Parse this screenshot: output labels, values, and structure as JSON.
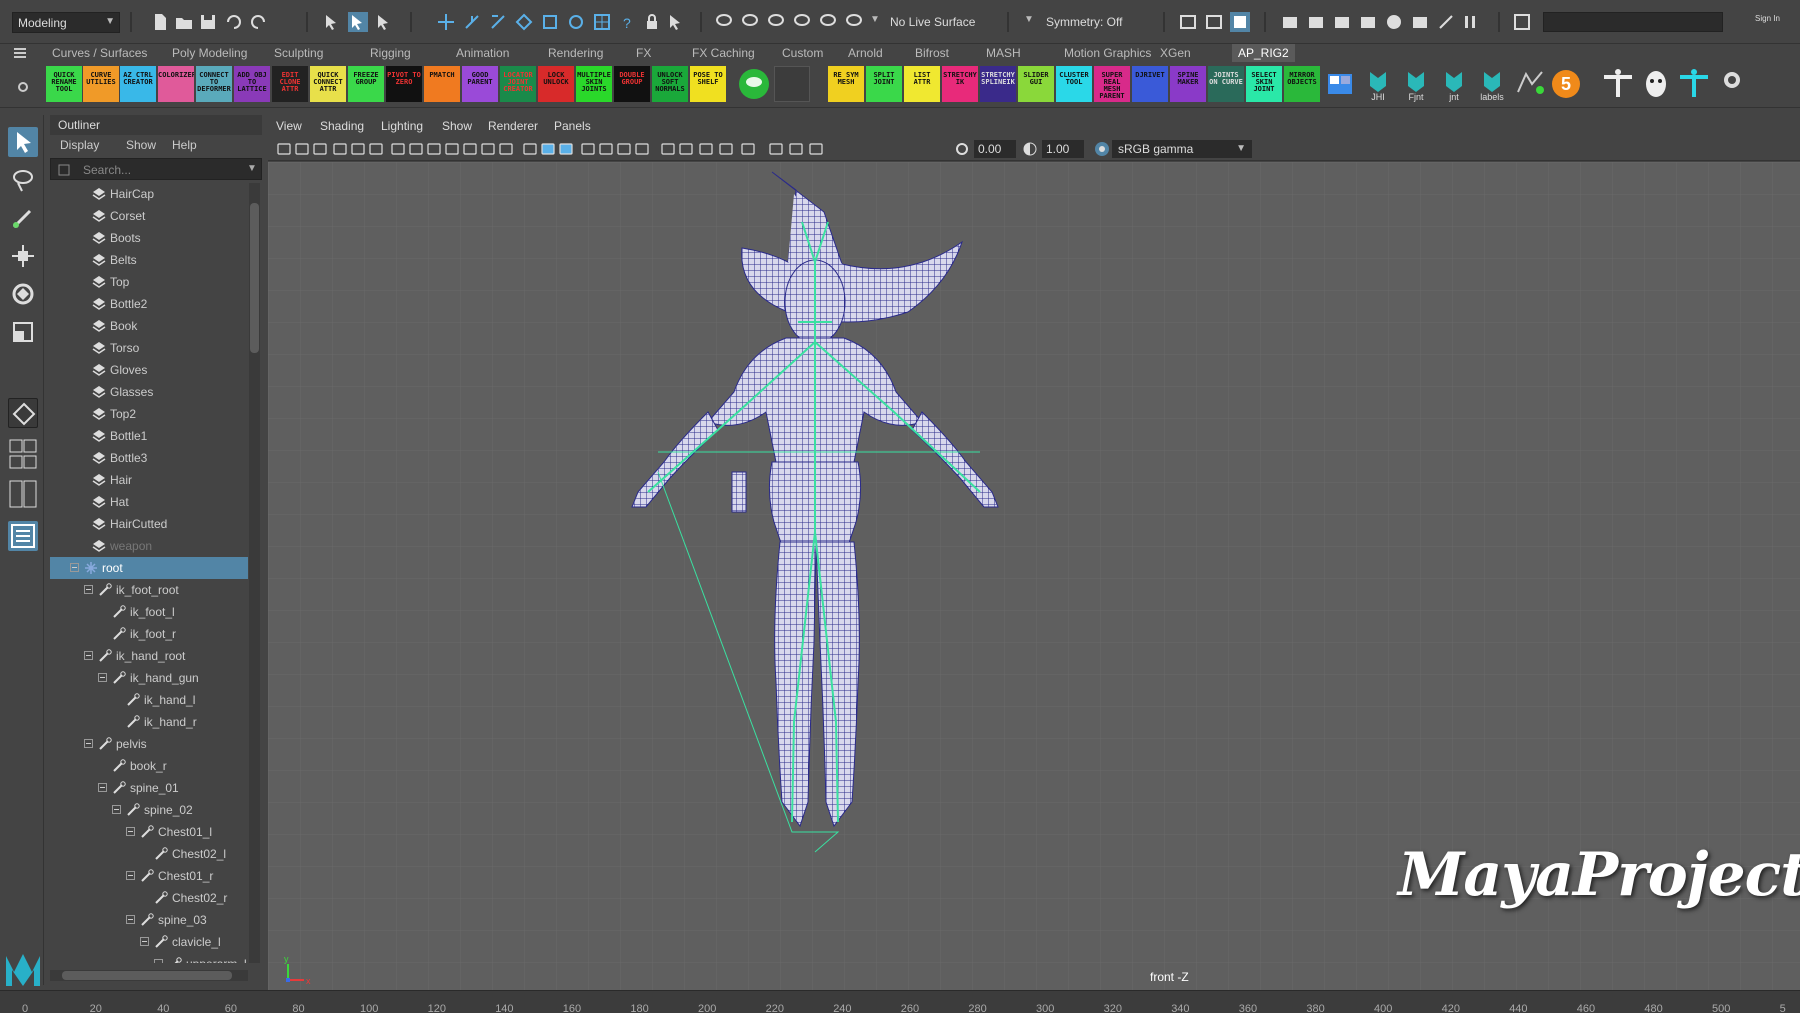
{
  "status_line": {
    "mode": "Modeling",
    "live_surface": "No Live Surface",
    "symmetry": "Symmetry: Off",
    "sign_in": "Sign In"
  },
  "shelf_tabs": [
    "Curves / Surfaces",
    "Poly Modeling",
    "Sculpting",
    "Rigging",
    "Animation",
    "Rendering",
    "FX",
    "FX Caching",
    "Custom",
    "Arnold",
    "Bifrost",
    "MASH",
    "Motion Graphics",
    "XGen",
    "AP_RIG2"
  ],
  "active_shelf": "AP_RIG2",
  "shelf_buttons": [
    {
      "label": "QUICK RENAME TOOL",
      "color": "#3ad84a"
    },
    {
      "label": "CURVE UTILIES",
      "color": "#f09a28"
    },
    {
      "label": "AZ CTRL CREATOR",
      "color": "#39b8e8"
    },
    {
      "label": "COLORIZER",
      "color": "#e05a9a"
    },
    {
      "label": "CONNECT TO DEFORMER",
      "color": "#5aaabb"
    },
    {
      "label": "ADD OBJ TO LATTICE",
      "color": "#8a3ab8"
    },
    {
      "label": "EDIT CLONE ATTR",
      "color": "#222222"
    },
    {
      "label": "QUICK CONNECT ATTR",
      "color": "#e8e04a"
    },
    {
      "label": "FREEZE GROUP",
      "color": "#3ad84a"
    },
    {
      "label": "PIVOT TO ZERO",
      "color": "#111111"
    },
    {
      "label": "PMATCH",
      "color": "#f07a20"
    },
    {
      "label": "GOOD PARENT",
      "color": "#9a4ad8"
    },
    {
      "label": "LOCATOR JOINT CREATOR",
      "color": "#1a8a4a"
    },
    {
      "label": "LOCK UNLOCK",
      "color": "#d82a2a"
    },
    {
      "label": "MULTIPLE SKIN JOINTS",
      "color": "#2ad82a"
    },
    {
      "label": "DOUBLE GROUP",
      "color": "#111111"
    },
    {
      "label": "UNLOCK SOFT NORMALS",
      "color": "#1aa83a"
    },
    {
      "label": "POSE TO SHELF",
      "color": "#f0e020"
    },
    {
      "label": "RE SYM MESH",
      "color": "#f0d020"
    },
    {
      "label": "SPLIT JOINT",
      "color": "#3ad84a"
    },
    {
      "label": "LIST ATTR",
      "color": "#f0e830"
    },
    {
      "label": "STRETCHY IK",
      "color": "#e82a7a"
    },
    {
      "label": "STRETCHY SPLINEIK",
      "color": "#3a2a8a"
    },
    {
      "label": "SLIDER GUI",
      "color": "#8ad83a"
    },
    {
      "label": "CLUSTER TOOL",
      "color": "#2ad8e8"
    },
    {
      "label": "SUPER REAL MESH PARENT",
      "color": "#d82a8a"
    },
    {
      "label": "DJRIVET",
      "color": "#3a5ad8"
    },
    {
      "label": "SPINE MAKER",
      "color": "#8a3ac8"
    },
    {
      "label": "JOINTS ON CURVE",
      "color": "#2a6a5a"
    },
    {
      "label": "SELECT SKIN JOINT",
      "color": "#2ae8a8"
    },
    {
      "label": "MIRROR OBJECTS",
      "color": "#2ab83a"
    }
  ],
  "shelf_text_icons": [
    "JHI",
    "Fjnt",
    "jnt",
    "labels"
  ],
  "shelf_badge": "5",
  "outliner": {
    "title": "Outliner",
    "menu": [
      "Display",
      "Show",
      "Help"
    ],
    "search_placeholder": "Search...",
    "items": [
      {
        "label": "HairCap",
        "type": "mesh",
        "depth": 0
      },
      {
        "label": "Corset",
        "type": "mesh",
        "depth": 0
      },
      {
        "label": "Boots",
        "type": "mesh",
        "depth": 0
      },
      {
        "label": "Belts",
        "type": "mesh",
        "depth": 0
      },
      {
        "label": "Top",
        "type": "mesh",
        "depth": 0
      },
      {
        "label": "Bottle2",
        "type": "mesh",
        "depth": 0
      },
      {
        "label": "Book",
        "type": "mesh",
        "depth": 0
      },
      {
        "label": "Torso",
        "type": "mesh",
        "depth": 0
      },
      {
        "label": "Gloves",
        "type": "mesh",
        "depth": 0
      },
      {
        "label": "Glasses",
        "type": "mesh",
        "depth": 0
      },
      {
        "label": "Top2",
        "type": "mesh",
        "depth": 0
      },
      {
        "label": "Bottle1",
        "type": "mesh",
        "depth": 0
      },
      {
        "label": "Bottle3",
        "type": "mesh",
        "depth": 0
      },
      {
        "label": "Hair",
        "type": "mesh",
        "depth": 0
      },
      {
        "label": "Hat",
        "type": "mesh",
        "depth": 0
      },
      {
        "label": "HairCutted",
        "type": "mesh",
        "depth": 0
      },
      {
        "label": "weapon",
        "type": "mesh",
        "depth": 0,
        "dim": true
      },
      {
        "label": "root",
        "type": "joint",
        "depth": 0,
        "selected": true,
        "expander": true
      },
      {
        "label": "ik_foot_root",
        "type": "joint",
        "depth": 1,
        "expander": true
      },
      {
        "label": "ik_foot_l",
        "type": "joint",
        "depth": 2
      },
      {
        "label": "ik_foot_r",
        "type": "joint",
        "depth": 2
      },
      {
        "label": "ik_hand_root",
        "type": "joint",
        "depth": 1,
        "expander": true
      },
      {
        "label": "ik_hand_gun",
        "type": "joint",
        "depth": 2,
        "expander": true
      },
      {
        "label": "ik_hand_l",
        "type": "joint",
        "depth": 3
      },
      {
        "label": "ik_hand_r",
        "type": "joint",
        "depth": 3
      },
      {
        "label": "pelvis",
        "type": "joint",
        "depth": 1,
        "expander": true
      },
      {
        "label": "book_r",
        "type": "joint",
        "depth": 2
      },
      {
        "label": "spine_01",
        "type": "joint",
        "depth": 2,
        "expander": true
      },
      {
        "label": "spine_02",
        "type": "joint",
        "depth": 3,
        "expander": true
      },
      {
        "label": "Chest01_l",
        "type": "joint",
        "depth": 4,
        "expander": true
      },
      {
        "label": "Chest02_l",
        "type": "joint",
        "depth": 5
      },
      {
        "label": "Chest01_r",
        "type": "joint",
        "depth": 4,
        "expander": true
      },
      {
        "label": "Chest02_r",
        "type": "joint",
        "depth": 5
      },
      {
        "label": "spine_03",
        "type": "joint",
        "depth": 4,
        "expander": true
      },
      {
        "label": "clavicle_l",
        "type": "joint",
        "depth": 5,
        "expander": true
      },
      {
        "label": "upperarm_l",
        "type": "joint",
        "depth": 6,
        "expander": true
      }
    ]
  },
  "viewport": {
    "menu": [
      "View",
      "Shading",
      "Lighting",
      "Show",
      "Renderer",
      "Panels"
    ],
    "field_a": "0.00",
    "field_b": "1.00",
    "color_space": "sRGB gamma",
    "camera_label": "front -Z",
    "watermark": "MayaProject"
  },
  "timeline": {
    "ticks": [
      "0",
      "20",
      "40",
      "60",
      "80",
      "100",
      "120",
      "140",
      "160",
      "180",
      "200",
      "220",
      "240",
      "260",
      "280",
      "300",
      "320",
      "340",
      "360",
      "380",
      "400",
      "420",
      "440",
      "460",
      "480",
      "500",
      "5"
    ]
  }
}
